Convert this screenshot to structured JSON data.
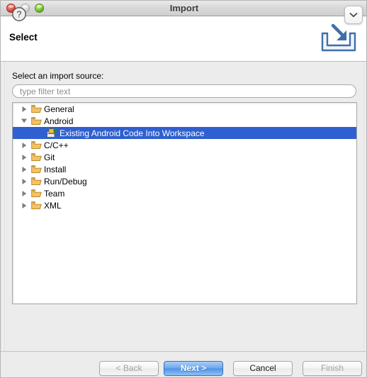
{
  "window": {
    "title": "Import",
    "traffic_lights": [
      "close-button",
      "minimize-button",
      "zoom-button"
    ]
  },
  "header": {
    "page_title": "Select",
    "collapse_icon": "chevron-down-icon",
    "banner_icon": "import-arrow-into-tray-icon"
  },
  "body": {
    "source_label": "Select an import source:",
    "filter": {
      "placeholder": "type filter text",
      "value": ""
    },
    "tree": [
      {
        "label": "General",
        "level": 0,
        "state": "collapsed",
        "icon": "folder-icon",
        "selected": false
      },
      {
        "label": "Android",
        "level": 0,
        "state": "expanded",
        "icon": "folder-icon",
        "selected": false
      },
      {
        "label": "Existing Android Code Into Workspace",
        "level": 1,
        "state": "leaf",
        "icon": "import-code-plus-icon",
        "selected": true
      },
      {
        "label": "C/C++",
        "level": 0,
        "state": "collapsed",
        "icon": "folder-icon",
        "selected": false
      },
      {
        "label": "Git",
        "level": 0,
        "state": "collapsed",
        "icon": "folder-icon",
        "selected": false
      },
      {
        "label": "Install",
        "level": 0,
        "state": "collapsed",
        "icon": "folder-icon",
        "selected": false
      },
      {
        "label": "Run/Debug",
        "level": 0,
        "state": "collapsed",
        "icon": "folder-icon",
        "selected": false
      },
      {
        "label": "Team",
        "level": 0,
        "state": "collapsed",
        "icon": "folder-icon",
        "selected": false
      },
      {
        "label": "XML",
        "level": 0,
        "state": "collapsed",
        "icon": "folder-icon",
        "selected": false
      }
    ]
  },
  "footer": {
    "help_icon": "question-mark-circle-icon",
    "buttons": [
      {
        "label": "< Back",
        "name": "back-button",
        "enabled": false,
        "default": false
      },
      {
        "label": "Next >",
        "name": "next-button",
        "enabled": true,
        "default": true
      },
      {
        "label": "Cancel",
        "name": "cancel-button",
        "enabled": true,
        "default": false
      },
      {
        "label": "Finish",
        "name": "finish-button",
        "enabled": false,
        "default": false
      }
    ]
  },
  "colors": {
    "selection_blue": "#2f5fd0",
    "default_button_blue": "#4f91e8",
    "folder_yellow": "#f0b951",
    "banner_icon_blue": "#3f6fa8"
  }
}
